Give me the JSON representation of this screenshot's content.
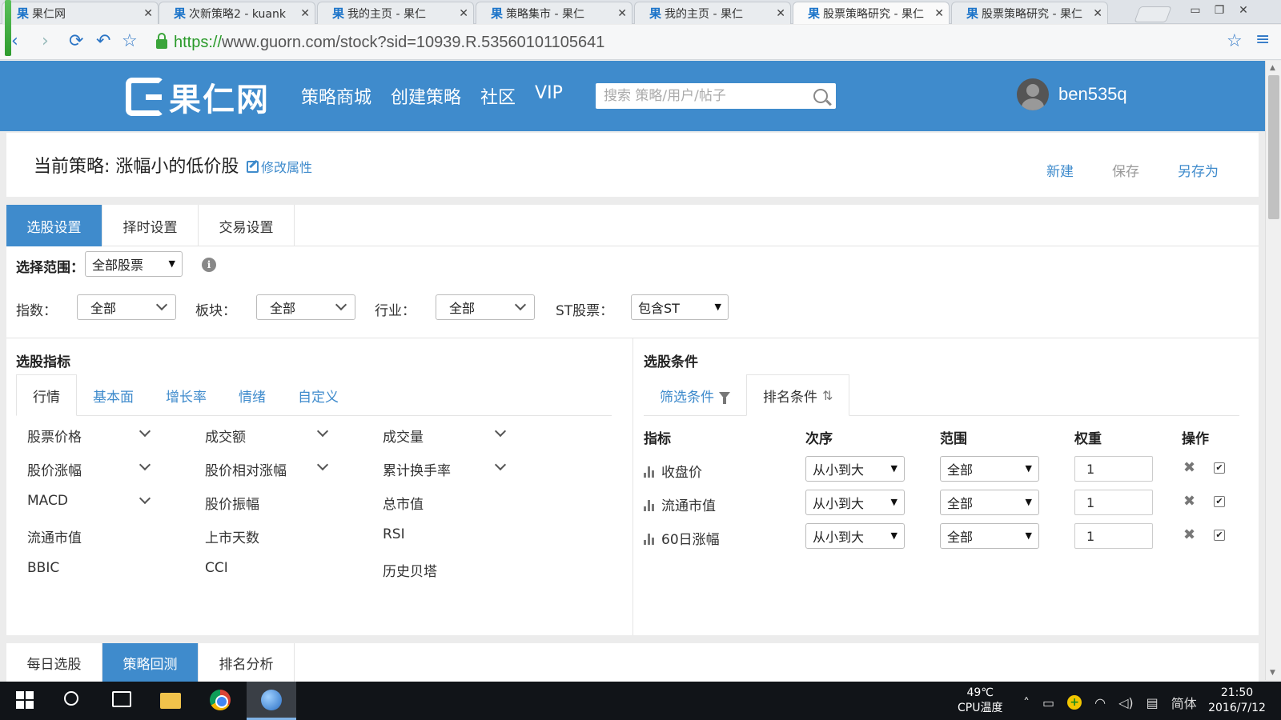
{
  "browser": {
    "tabs": [
      {
        "title": "果仁网"
      },
      {
        "title": "次新策略2 - kuank"
      },
      {
        "title": "我的主页 - 果仁"
      },
      {
        "title": "策略集市 - 果仁"
      },
      {
        "title": "我的主页 - 果仁"
      },
      {
        "title": "股票策略研究 - 果仁"
      },
      {
        "title": "股票策略研究 - 果仁"
      }
    ],
    "favicon": "果",
    "url_scheme": "https://",
    "url_rest": "www.guorn.com/stock?sid=10939.R.53560101105641"
  },
  "site": {
    "logo_text": "果仁网",
    "nav": [
      "策略商城",
      "创建策略",
      "社区",
      "VIP"
    ],
    "search_placeholder": "搜索 策略/用户/帖子",
    "username": "ben535q",
    "brand_color": "#3f8bcc"
  },
  "strategy": {
    "title": "当前策略: 涨幅小的低价股",
    "edit_label": "修改属性",
    "actions": {
      "new": "新建",
      "save": "保存",
      "save_as": "另存为"
    }
  },
  "settings": {
    "tabs": [
      "选股设置",
      "择时设置",
      "交易设置"
    ],
    "scope_label": "选择范围：",
    "scope_value": "全部股票",
    "filters": {
      "index_label": "指数：",
      "index_value": "全部",
      "sector_label": "板块：",
      "sector_value": "全部",
      "industry_label": "行业：",
      "industry_value": "全部",
      "st_label": "ST股票：",
      "st_value": "包含ST"
    }
  },
  "indicators": {
    "title": "选股指标",
    "tabs": [
      "行情",
      "基本面",
      "增长率",
      "情绪",
      "自定义"
    ],
    "items": [
      [
        "股票价格",
        "成交额",
        "成交量"
      ],
      [
        "股价涨幅",
        "股价相对涨幅",
        "累计换手率"
      ],
      [
        "MACD",
        "股价振幅",
        "总市值"
      ],
      [
        "流通市值",
        "上市天数",
        "RSI"
      ],
      [
        "BBIC",
        "CCI",
        "历史贝塔"
      ]
    ]
  },
  "conditions": {
    "title": "选股条件",
    "tabs": [
      "筛选条件",
      "排名条件"
    ],
    "headers": [
      "指标",
      "次序",
      "范围",
      "权重",
      "操作"
    ],
    "rows": [
      {
        "indicator": "收盘价",
        "order": "从小到大",
        "range": "全部",
        "weight": "1",
        "checked": "✔"
      },
      {
        "indicator": "流通市值",
        "order": "从小到大",
        "range": "全部",
        "weight": "1",
        "checked": "✔"
      },
      {
        "indicator": "60日涨幅",
        "order": "从小到大",
        "range": "全部",
        "weight": "1",
        "checked": "✔"
      }
    ]
  },
  "bottom_tabs": [
    "每日选股",
    "策略回测",
    "排名分析"
  ],
  "taskbar": {
    "temp": "49℃",
    "temp_label": "CPU温度",
    "ime": "简体",
    "time": "21:50",
    "date": "2016/7/12"
  }
}
